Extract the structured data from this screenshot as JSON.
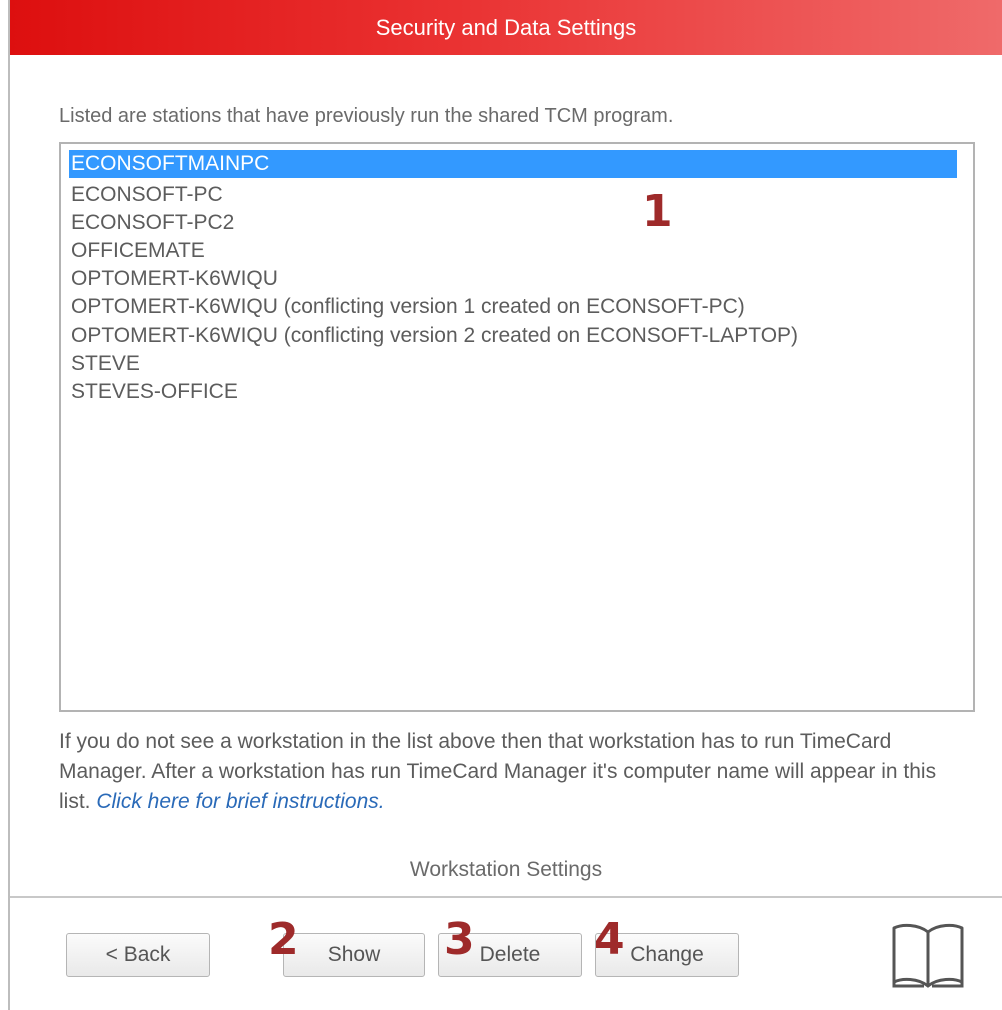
{
  "window": {
    "title": "Security and Data Settings"
  },
  "intro_text": "Listed are stations that have previously run the shared TCM program.",
  "stations": [
    "ECONSOFTMAINPC",
    "ECONSOFT-PC",
    "ECONSOFT-PC2",
    "OFFICEMATE",
    "OPTOMERT-K6WIQU",
    "OPTOMERT-K6WIQU (conflicting version 1 created on ECONSOFT-PC)",
    "OPTOMERT-K6WIQU (conflicting version 2 created on ECONSOFT-LAPTOP)",
    "STEVE",
    "STEVES-OFFICE"
  ],
  "selected_station": "ECONSOFTMAINPC",
  "info": {
    "text": "If you do not see a workstation in the list above then that workstation has to run TimeCard Manager. After a workstation has run TimeCard Manager it's computer name will appear in this list.",
    "link": "Click here for brief instructions."
  },
  "section_label": "Workstation Settings",
  "buttons": {
    "back": "< Back",
    "show": "Show",
    "delete": "Delete",
    "change": "Change"
  },
  "annotations": [
    "1",
    "2",
    "3",
    "4"
  ],
  "icons": {
    "help": "open-book-icon"
  },
  "colors": {
    "title_start": "#dd0f0f",
    "title_end": "#ef6a6a",
    "selection": "#3399ff",
    "link": "#2a6ab8",
    "annotation": "#9e2a2a"
  }
}
